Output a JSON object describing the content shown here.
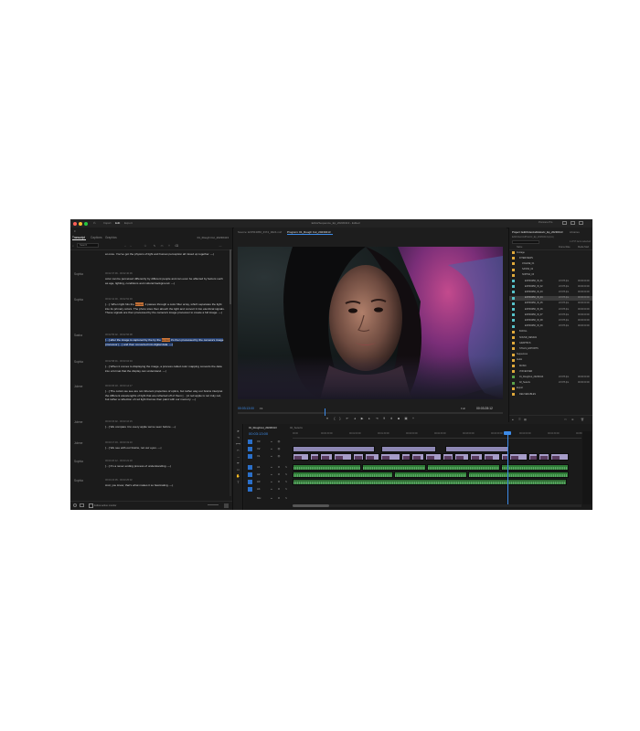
{
  "window": {
    "title": "EditorSequence_Ep_20230413 - Edited",
    "workspace_tabs": [
      "Import",
      "Edit",
      "Export"
    ],
    "active_workspace": "Edit",
    "home_icon": "home-icon",
    "right_label": "Premiere Pro"
  },
  "left_panel": {
    "tabs": [
      "Transcript",
      "Captions",
      "Graphics"
    ],
    "active_tab": "Transcript",
    "sequence_name": "01_Rough Cut_20230413",
    "search_placeholder": "Search",
    "follow_label": "Follow active monitor",
    "transcript": [
      {
        "speaker": "",
        "time": "",
        "text": "at once. You've got the physics of light and human perception all mixed up together. —|"
      },
      {
        "speaker": "Sophia",
        "time": "00:02:37:06 - 00:02:40:06",
        "text": "color can be perceived differently by different people and can even be affected by factors such as age, lighting, conditions and cultural background. —|"
      },
      {
        "speaker": "Sophia",
        "time": "00:02:41:00 - 00:02:52:03",
        "text_pre": "[···]. When light hits the ",
        "highlight": "sensor",
        "text_post": ", it passes through a color filter array, which separates the light into its primary colors. The photo sites then absorb the light and convert it into electrical signals. These signals are then processed by the camera's image processor to create a full image. —|"
      },
      {
        "speaker": "Sasha",
        "time": "00:02:55:02 - 00:02:56:08",
        "sel_pre": "[···] after the image is captured by the by the ",
        "highlight": "sensor",
        "sel_post": " it's then processed by the camera's image processor [···] and then converted into digital data. —|"
      },
      {
        "speaker": "Sophia",
        "time": "00:02:58:01 - 00:03:04:04",
        "text": "[···] When it comes to displaying the image, a process called color mapping converts the data into a format that the display can understand. —|"
      },
      {
        "speaker": "Jolene",
        "time": "00:03:05:18 - 00:03:14:17",
        "text": "[···] The colors we see are not inherent properties of optics, but rather way our brains interpret the different wavelengths of light that are reflected off of them [···] A red apple is not truly red, but rather a reflection of red light that we then paint with our memory. —|"
      },
      {
        "speaker": "Jolene",
        "time": "00:03:15:02 - 00:03:16:15",
        "text": "[···] We compare it to every apple we've seen before. —|"
      },
      {
        "speaker": "Jolene",
        "time": "00:03:17:03 - 00:03:19:10",
        "text": "[···] We see with our brains, not our eyes. —|"
      },
      {
        "speaker": "Sophia",
        "time": "00:03:20:12 - 00:03:22:18",
        "text": "[···] It's a never ending process of understanding. —|"
      },
      {
        "speaker": "Sophia",
        "time": "00:03:23:05 - 00:03:25:02",
        "text": "And, you know, that's what makes it so fascinating. —|"
      }
    ]
  },
  "monitor": {
    "source_tab": "Source: EXPR4056_IN74_0024.mxf",
    "program_tab": "Program: 01_Rough Cut_20230413",
    "timecode": "00:03:13:00",
    "fit": "Fit",
    "resolution": "Full",
    "duration": "00:03:28:12"
  },
  "project": {
    "tab": "Project: EditOrderAndHistoric_Ep_20230413",
    "tab2": "Libraries",
    "subtitle": "EditOrderAndHistoric_Ep_20230413.prproj",
    "count": "1 of 57 items selected",
    "columns": [
      "Name",
      "Frame Rate",
      "Media Start"
    ],
    "rows": [
      {
        "name": "Footage",
        "color": "#e0a93a",
        "fr": "",
        "ms": "",
        "indent": 0,
        "sel": false
      },
      {
        "name": "INTERVIEWS",
        "color": "#e0a93a",
        "fr": "",
        "ms": "",
        "indent": 1,
        "sel": false
      },
      {
        "name": "JOLENE_01",
        "color": "#e0a93a",
        "fr": "",
        "ms": "",
        "indent": 2,
        "sel": false
      },
      {
        "name": "SASHA_02",
        "color": "#e0a93a",
        "fr": "",
        "ms": "",
        "indent": 2,
        "sel": false
      },
      {
        "name": "SOPHIA_03",
        "color": "#e0a93a",
        "fr": "",
        "ms": "",
        "indent": 2,
        "sel": false
      },
      {
        "name": "EXPR4056_IN_01",
        "color": "#56c2c9",
        "fr": "23.976 fps",
        "ms": "00:00:00:00",
        "indent": 3,
        "sel": false
      },
      {
        "name": "EXPR4056_IN_02",
        "color": "#56c2c9",
        "fr": "23.976 fps",
        "ms": "00:00:00:00",
        "indent": 3,
        "sel": false
      },
      {
        "name": "EXPR4056_IN_03",
        "color": "#56c2c9",
        "fr": "23.976 fps",
        "ms": "00:00:00:00",
        "indent": 3,
        "sel": false
      },
      {
        "name": "EXPR4056_IN_04",
        "color": "#56c2c9",
        "fr": "23.976 fps",
        "ms": "00:00:00:00",
        "indent": 3,
        "sel": true
      },
      {
        "name": "EXPR4056_IN_05",
        "color": "#56c2c9",
        "fr": "23.976 fps",
        "ms": "00:00:00:00",
        "indent": 3,
        "sel": false
      },
      {
        "name": "EXPR4056_IN_06",
        "color": "#56c2c9",
        "fr": "23.976 fps",
        "ms": "00:00:00:00",
        "indent": 3,
        "sel": false
      },
      {
        "name": "EXPR4056_IN_07",
        "color": "#56c2c9",
        "fr": "23.976 fps",
        "ms": "00:00:00:00",
        "indent": 3,
        "sel": false
      },
      {
        "name": "EXPR4056_IN_08",
        "color": "#56c2c9",
        "fr": "23.976 fps",
        "ms": "00:00:00:00",
        "indent": 3,
        "sel": false
      },
      {
        "name": "EXPR4056_IN_09",
        "color": "#56c2c9",
        "fr": "23.976 fps",
        "ms": "00:00:00:00",
        "indent": 3,
        "sel": false
      },
      {
        "name": "B-ROLL",
        "color": "#e0a93a",
        "fr": "",
        "ms": "",
        "indent": 1,
        "sel": false
      },
      {
        "name": "SOUND_DESIGN",
        "color": "#e0a93a",
        "fr": "",
        "ms": "",
        "indent": 1,
        "sel": false
      },
      {
        "name": "GRAPHICS",
        "color": "#e0a93a",
        "fr": "",
        "ms": "",
        "indent": 1,
        "sel": false
      },
      {
        "name": "STILLS_EXPORTS",
        "color": "#e0a93a",
        "fr": "",
        "ms": "",
        "indent": 1,
        "sel": false
      },
      {
        "name": "Sequences",
        "color": "#e0a93a",
        "fr": "",
        "ms": "",
        "indent": 0,
        "sel": false
      },
      {
        "name": "Audio",
        "color": "#e0a93a",
        "fr": "",
        "ms": "",
        "indent": 0,
        "sel": false
      },
      {
        "name": "MUSIC",
        "color": "#e0a93a",
        "fr": "",
        "ms": "",
        "indent": 1,
        "sel": false
      },
      {
        "name": "VOICEOVER",
        "color": "#e0a93a",
        "fr": "",
        "ms": "",
        "indent": 1,
        "sel": false
      },
      {
        "name": "01_Roughcut_20230413",
        "color": "#5aa14a",
        "fr": "23.976 fps",
        "ms": "00:00:00:00",
        "indent": 1,
        "sel": false
      },
      {
        "name": "02_Selects",
        "color": "#5aa14a",
        "fr": "23.976 fps",
        "ms": "00:00:00:00",
        "indent": 1,
        "sel": false
      },
      {
        "name": "Export",
        "color": "#e0a93a",
        "fr": "",
        "ms": "",
        "indent": 0,
        "sel": false
      },
      {
        "name": "DELIVERABLES",
        "color": "#e0a93a",
        "fr": "",
        "ms": "",
        "indent": 1,
        "sel": false
      }
    ]
  },
  "timeline": {
    "tab": "01_Roughcut_20230413",
    "tab2": "02_Selects",
    "timecode": "00:03:13:00",
    "ruler_labels": [
      "00:00",
      "00:00:30:00",
      "00:01:00:00",
      "00:01:30:00",
      "00:02:00:00",
      "00:02:30:00",
      "00:03:00:00",
      "00:03:30:00",
      "00:04:00:00",
      "00:04:30:00",
      "00:05:00:00"
    ],
    "tracks": [
      "V3",
      "V2",
      "V1",
      "A1",
      "A2",
      "A3",
      "A4",
      "Mix"
    ],
    "clip_label": "EXPR4056_IN74"
  }
}
